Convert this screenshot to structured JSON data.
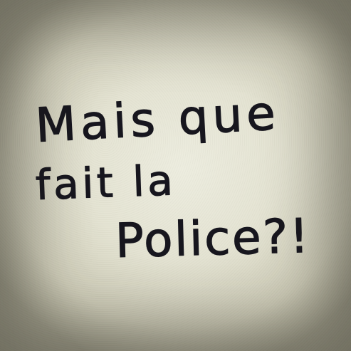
{
  "handwriting": {
    "line1": "Mais que",
    "line2": "fait la",
    "line3": "Police?!"
  },
  "colors": {
    "wall": "#e6e5d5",
    "ink": "#17161e"
  }
}
